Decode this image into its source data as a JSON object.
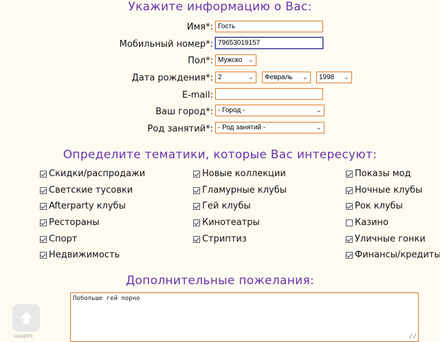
{
  "section_titles": {
    "info": "Укажите информацию о Вас:",
    "topics": "Определите тематики, которые Вас интересуют:",
    "wishes": "Дополнительные пожелания:"
  },
  "form": {
    "name": {
      "label": "Имя*:",
      "value": "Гость"
    },
    "phone": {
      "label": "Мобильный номер*:",
      "value": "79653019157"
    },
    "gender": {
      "label": "Пол*:",
      "value": "Мужско"
    },
    "birthdate": {
      "label": "Дата рождения*:",
      "day": "2",
      "month": "Февраль",
      "year": "1998"
    },
    "email": {
      "label": "E-mail:",
      "value": ""
    },
    "city": {
      "label": "Ваш город*:",
      "value": "- Город -"
    },
    "occupation": {
      "label": "Род занятий*:",
      "value": "- Род занятий -"
    }
  },
  "topics": {
    "col1": [
      {
        "label": "Скидки/распродажи",
        "checked": true
      },
      {
        "label": "Светские тусовки",
        "checked": true
      },
      {
        "label": "Afterparty клубы",
        "checked": true
      },
      {
        "label": "Рестораны",
        "checked": true
      },
      {
        "label": "Спорт",
        "checked": true
      },
      {
        "label": "Недвижимость",
        "checked": true
      }
    ],
    "col2": [
      {
        "label": "Новые коллекции",
        "checked": true
      },
      {
        "label": "Гламурные клубы",
        "checked": true
      },
      {
        "label": "Гей клубы",
        "checked": true
      },
      {
        "label": "Кинотеатры",
        "checked": true
      },
      {
        "label": "Стриптиз",
        "checked": true
      }
    ],
    "col3": [
      {
        "label": "Показы мод",
        "checked": true
      },
      {
        "label": "Ночные клубы",
        "checked": true
      },
      {
        "label": "Рок клубы",
        "checked": true
      },
      {
        "label": "Казино",
        "checked": false
      },
      {
        "label": "Уличные гонки",
        "checked": true
      },
      {
        "label": "Финансы/кредиты",
        "checked": true
      }
    ]
  },
  "wishes_text": "Побольше гей порно",
  "up_button": {
    "icon": "arrow-up-icon",
    "caption": "НАВЕРХ"
  },
  "colors": {
    "title": "#6633aa",
    "field_border": "#e07a2a",
    "background": "#fefbf1"
  }
}
